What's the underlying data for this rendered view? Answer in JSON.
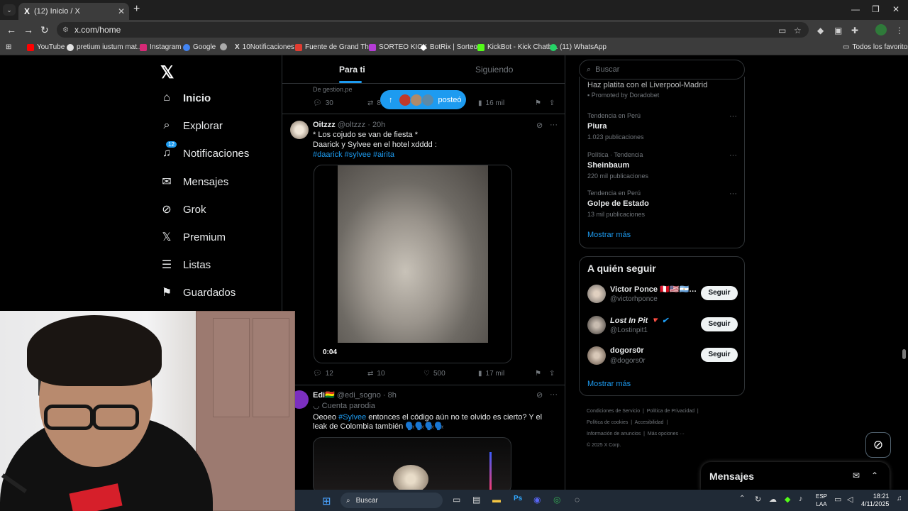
{
  "browser": {
    "tab_title": "(12) Inicio / X",
    "tab_favicon": "X",
    "url": "x.com/home",
    "bookmarks": [
      {
        "label": "YouTube",
        "color": "#ff0000"
      },
      {
        "label": "pretium iustum mat...",
        "color": "#e3e3e3"
      },
      {
        "label": "Instagram",
        "color": "#d62976"
      },
      {
        "label": "Google",
        "color": "#4285f4"
      },
      {
        "label": "",
        "color": "#aaaaaa"
      },
      {
        "label": "10Notificaciones",
        "color": "#ffffff"
      },
      {
        "label": "Fuente de Grand Th...",
        "color": "#e03c31"
      },
      {
        "label": "SORTEO KICK",
        "color": "#b43cd6"
      },
      {
        "label": "BotRix | Sorteos",
        "color": "#ffffff"
      },
      {
        "label": "KickBot - Kick Chatb...",
        "color": "#53fc18"
      },
      {
        "label": "(11) WhatsApp",
        "color": "#25d366"
      }
    ],
    "all_favorites": "Todos los favoritos"
  },
  "nav": {
    "items": [
      {
        "label": "Inicio",
        "icon": "home-icon"
      },
      {
        "label": "Explorar",
        "icon": "search-icon"
      },
      {
        "label": "Notificaciones",
        "icon": "bell-icon",
        "badge": "12"
      },
      {
        "label": "Mensajes",
        "icon": "envelope-icon"
      },
      {
        "label": "Grok",
        "icon": "grok-icon"
      },
      {
        "label": "Premium",
        "icon": "x-icon"
      },
      {
        "label": "Listas",
        "icon": "list-icon"
      },
      {
        "label": "Guardados",
        "icon": "bookmark-icon"
      }
    ]
  },
  "feed": {
    "tab_for_you": "Para ti",
    "tab_following": "Siguiendo",
    "posted_pill": "posteó",
    "prev_post": {
      "source": "De gestion.pe",
      "replies": "30",
      "reposts": "8",
      "views": "16 mil"
    },
    "post1": {
      "name": "Oitzzz",
      "handle": "@oltzzz",
      "time": "20h",
      "line1": "* Los cojudo se van de fiesta *",
      "line2": "Daarick y Sylvee en el hotel xdddd :",
      "hashtags": "#daarick #sylvee #airita",
      "video_time": "0:04",
      "replies": "12",
      "reposts": "10",
      "likes": "500",
      "views": "17 mil"
    },
    "post2": {
      "name": "Edi🇧🇴",
      "handle": "@edi_sogno",
      "time": "8h",
      "label": "Cuenta parodia",
      "text_a": "Oeoeo ",
      "hashtag": "#Sylvee",
      "text_b": " entonces el código aún no te olvido es cierto? Y el leak de Colombia también 🗣️🗣️🗣️🗣️"
    }
  },
  "sidebar": {
    "search_placeholder": "Buscar",
    "promo": "Haz platita con el Liverpool-Madrid",
    "promoted_by": "Promoted by Doradobet",
    "trends": [
      {
        "category": "Tendencia en Perú",
        "topic": "Piura",
        "count": "1.023 publicaciones"
      },
      {
        "category": "Política · Tendencia",
        "topic": "Sheinbaum",
        "count": "220 mil publicaciones"
      },
      {
        "category": "Tendencia en Perú",
        "topic": "Golpe de Estado",
        "count": "13 mil publicaciones"
      }
    ],
    "show_more": "Mostrar más",
    "who_to_follow": "A quién seguir",
    "follows": [
      {
        "name": "Victor Ponce 🇵🇪🇺🇸🇦🇷…",
        "handle": "@victorhponce",
        "button": "Seguir"
      },
      {
        "name": "Lost In Pit 🔻",
        "handle": "@Lostinpit1",
        "button": "Seguir"
      },
      {
        "name": "dogors0r",
        "handle": "@dogors0r",
        "button": "Seguir"
      }
    ],
    "footer": [
      "Condiciones de Servicio",
      "Política de Privacidad",
      "Política de cookies",
      "Accesibilidad",
      "Información de anuncios",
      "Más opciones ···",
      "© 2025 X Corp."
    ],
    "messages_drawer": "Mensajes"
  },
  "taskbar": {
    "search": "Buscar",
    "lang_top": "ESP",
    "lang_bottom": "LAA",
    "time": "18:21",
    "date": "4/11/2025"
  },
  "colors": {
    "accent": "#1d9bf0",
    "bg": "#000000",
    "border": "#2f3336",
    "muted": "#71767b"
  }
}
